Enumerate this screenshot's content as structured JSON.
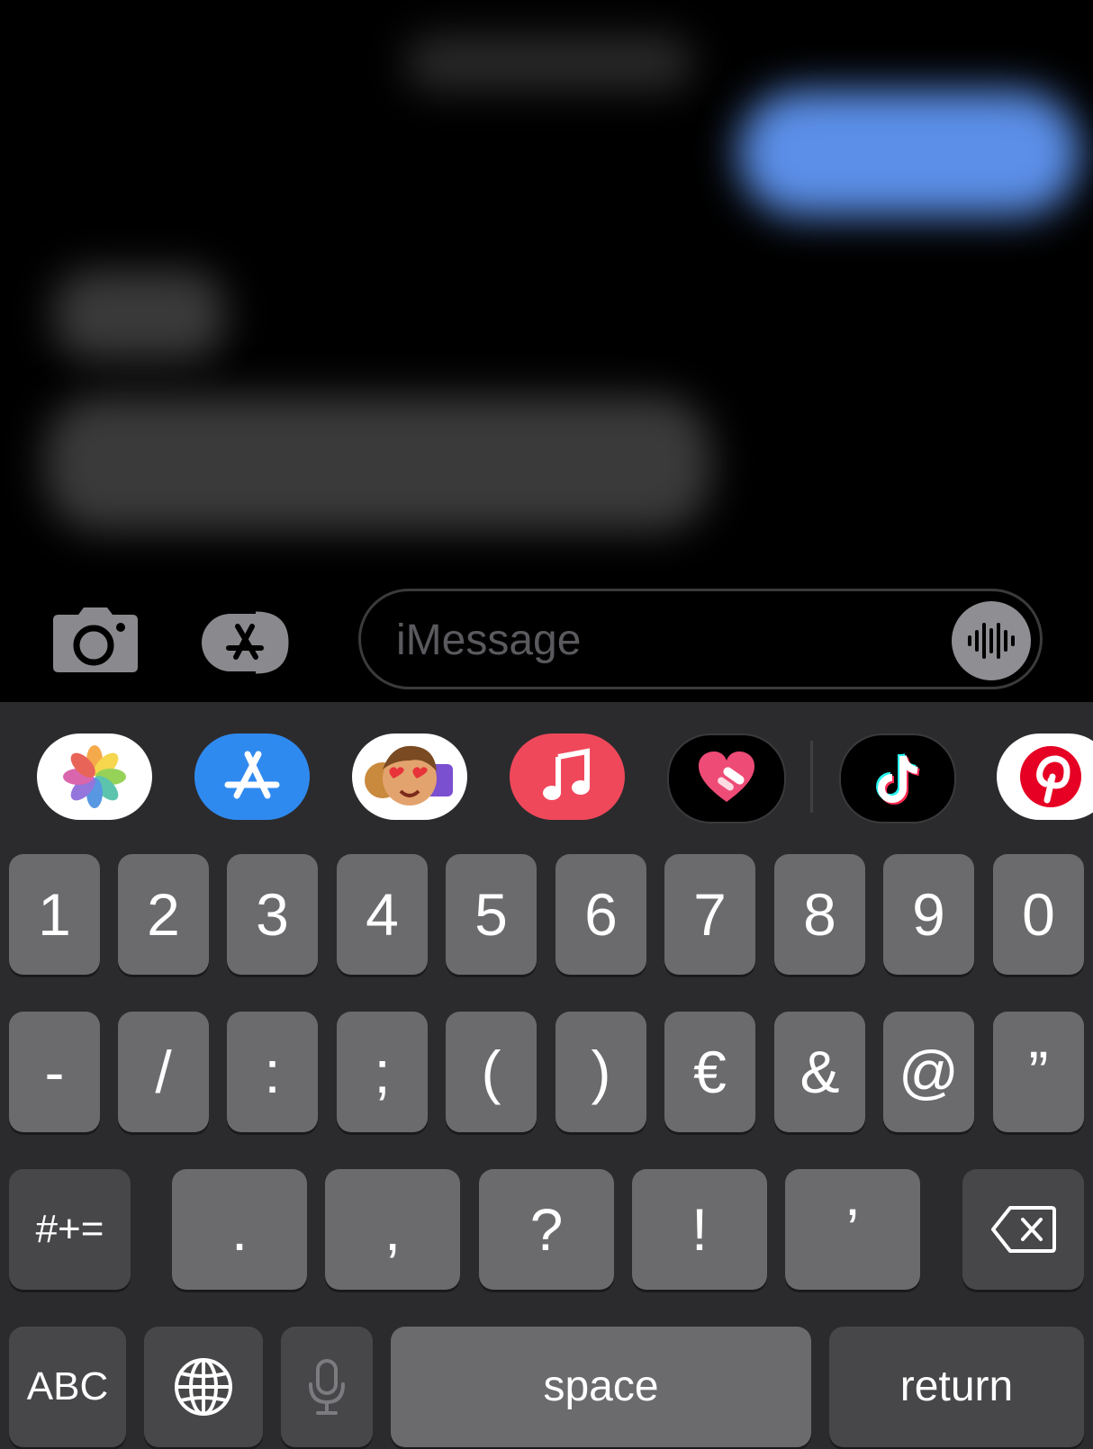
{
  "composer": {
    "placeholder": "iMessage"
  },
  "apps": [
    {
      "name": "photos-app-icon"
    },
    {
      "name": "app-store-app-icon"
    },
    {
      "name": "memoji-app-icon"
    },
    {
      "name": "music-app-icon"
    },
    {
      "name": "heart-app-icon"
    },
    {
      "name": "tiktok-app-icon"
    },
    {
      "name": "pinterest-app-icon"
    }
  ],
  "keyboard": {
    "row1": [
      "1",
      "2",
      "3",
      "4",
      "5",
      "6",
      "7",
      "8",
      "9",
      "0"
    ],
    "row2": [
      "-",
      "/",
      ":",
      ";",
      "(",
      ")",
      "€",
      "&",
      "@",
      "”"
    ],
    "row3": [
      ".",
      ",",
      "?",
      "!",
      "’"
    ],
    "shift_label": "#+=",
    "abc_label": "ABC",
    "space_label": "space",
    "return_label": "return"
  },
  "colors": {
    "key": "#6b6b6e",
    "key_dark": "#474749",
    "keyboard_bg": "#2b2b2d",
    "accent_blue": "#5b8fe8"
  }
}
